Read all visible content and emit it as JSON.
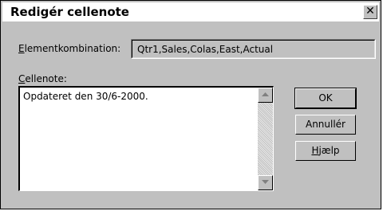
{
  "dialog": {
    "title": "Redigér cellenote",
    "close_glyph": "✕"
  },
  "element_combination": {
    "label_accel": "E",
    "label_rest": "lementkombination:",
    "value": "Qtr1,Sales,Colas,East,Actual"
  },
  "cell_note": {
    "label_accel": "C",
    "label_rest": "ellenote:",
    "text": "Opdateret den 30/6-2000."
  },
  "buttons": {
    "ok_label": "OK",
    "cancel_label": "Annullér",
    "help_accel": "H",
    "help_rest": "jælp"
  },
  "icons": {
    "scroll_up": "scroll-up-arrow-icon",
    "scroll_down": "scroll-down-arrow-icon",
    "close": "close-icon"
  }
}
